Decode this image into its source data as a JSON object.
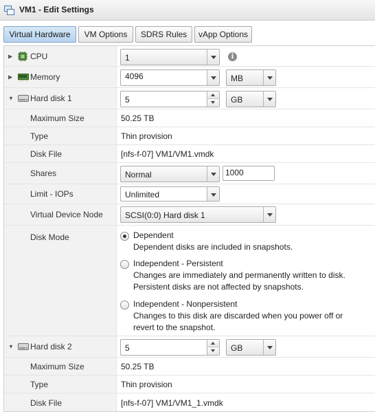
{
  "window": {
    "title": "VM1 - Edit Settings",
    "icon": "vm-icon"
  },
  "tabs": [
    {
      "label": "Virtual Hardware",
      "active": true
    },
    {
      "label": "VM Options",
      "active": false
    },
    {
      "label": "SDRS Rules",
      "active": false
    },
    {
      "label": "vApp Options",
      "active": false
    }
  ],
  "cpu": {
    "label": "CPU",
    "value": "1",
    "icon": "cpu-icon"
  },
  "memory": {
    "label": "Memory",
    "value": "4096",
    "unit": "MB",
    "icon": "memory-icon"
  },
  "disk1": {
    "label": "Hard disk 1",
    "size": "5",
    "unit": "GB",
    "icon": "hard-disk-icon",
    "max_size_label": "Maximum Size",
    "max_size": "50.25 TB",
    "type_label": "Type",
    "type": "Thin provision",
    "file_label": "Disk File",
    "file": "[nfs-f-07] VM1/VM1.vmdk",
    "shares_label": "Shares",
    "shares": "Normal",
    "shares_value": "1000",
    "limit_label": "Limit - IOPs",
    "limit": "Unlimited",
    "node_label": "Virtual Device Node",
    "node": "SCSI(0:0) Hard disk 1",
    "mode_label": "Disk Mode",
    "modes": [
      {
        "label": "Dependent",
        "desc1": "Dependent disks are included in snapshots.",
        "desc2": "",
        "selected": true
      },
      {
        "label": "Independent - Persistent",
        "desc1": "Changes are immediately and permanently written to disk.",
        "desc2": "Persistent disks are not affected by snapshots.",
        "selected": false
      },
      {
        "label": "Independent - Nonpersistent",
        "desc1": "Changes to this disk are discarded when you power off or",
        "desc2": "revert to the snapshot.",
        "selected": false
      }
    ]
  },
  "disk2": {
    "label": "Hard disk 2",
    "size": "5",
    "unit": "GB",
    "icon": "hard-disk-icon",
    "max_size_label": "Maximum Size",
    "max_size": "50.25 TB",
    "type_label": "Type",
    "type": "Thin provision",
    "file_label": "Disk File",
    "file": "[nfs-f-07] VM1/VM1_1.vmdk"
  }
}
